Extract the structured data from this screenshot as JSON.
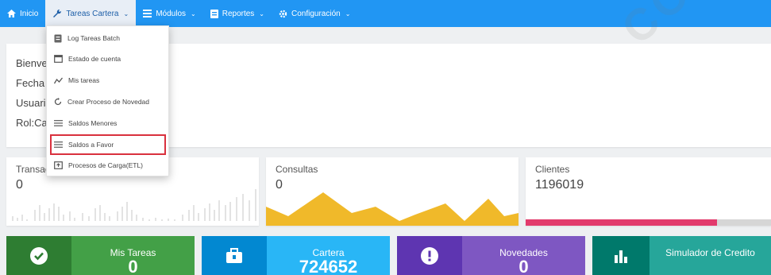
{
  "nav": {
    "home": "Inicio",
    "tareas": "Tareas Cartera",
    "modulos": "Módulos",
    "reportes": "Reportes",
    "config": "Configuración"
  },
  "dropdown": {
    "items": [
      {
        "label": "Log Tareas Batch",
        "icon": "document-icon"
      },
      {
        "label": "Estado de cuenta",
        "icon": "calendar-icon"
      },
      {
        "label": "Mis tareas",
        "icon": "trend-icon"
      },
      {
        "label": "Crear Proceso de Novedad",
        "icon": "refresh-icon"
      },
      {
        "label": "Saldos Menores",
        "icon": "list-icon"
      },
      {
        "label": "Saldos a Favor",
        "icon": "list-icon",
        "highlighted": true
      },
      {
        "label": "Procesos de Carga(ETL)",
        "icon": "upload-icon"
      }
    ]
  },
  "welcome": {
    "line1": "Bienve",
    "line2": "Fecha",
    "line3": "Usuario",
    "line4": "Rol:Car"
  },
  "stats": {
    "transacciones": {
      "title": "Transac",
      "value": "0"
    },
    "consultas": {
      "title": "Consultas",
      "value": "0"
    },
    "clientes": {
      "title": "Clientes",
      "value": "1196019",
      "progress": 0.78
    }
  },
  "tiles": [
    {
      "label": "Mis Tareas",
      "value": "0",
      "icon": "check-circle-icon",
      "color": "#43a047",
      "dark": "#2e7d32"
    },
    {
      "label": "Cartera",
      "value": "724652",
      "icon": "briefcase-icon",
      "color": "#29b6f6",
      "dark": "#0288d1"
    },
    {
      "label": "Novedades",
      "value": "0",
      "icon": "alert-icon",
      "color": "#7e57c2",
      "dark": "#5e35b1"
    },
    {
      "label": "Simulador de Credito",
      "value": "",
      "icon": "bar-chart-icon",
      "color": "#26a69a",
      "dark": "#00796b"
    }
  ],
  "colors": {
    "nav": "#2196f3",
    "consultas_area": "#f0b92a",
    "clientes_bar": "#e23a6c",
    "highlight": "#d9313e"
  },
  "watermark": "CONTROL"
}
